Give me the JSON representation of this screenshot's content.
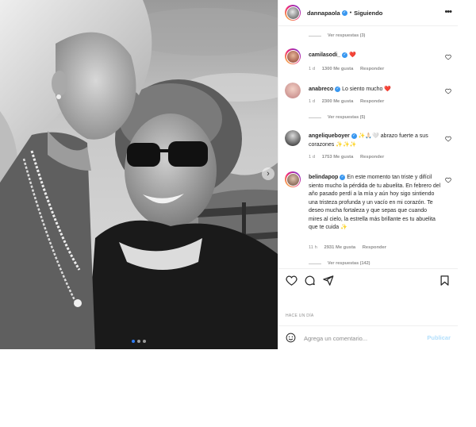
{
  "post": {
    "author": "dannapaola",
    "follow_state": "Siguiendo",
    "separator": "•",
    "posted_time": "HACE UN DÍA",
    "carousel": {
      "count": 3,
      "active": 0
    }
  },
  "icons": {
    "more": "more-horizontal-icon",
    "heart": "heart-outline-icon",
    "comment": "comment-bubble-icon",
    "share": "paper-plane-icon",
    "save": "bookmark-icon",
    "emoji": "smiley-icon",
    "verified": "verified-badge-icon"
  },
  "colors": {
    "verified": "#3897f0",
    "link_blue_disabled": "#b2dffc",
    "muted": "#8e8e8e"
  },
  "thread": {
    "replies_1": "Ver respuestas (3)",
    "replies_2": "Ver respuestas (5)",
    "replies_3": "Ver respuestas (142)"
  },
  "comments": [
    {
      "user": "camilasodi_",
      "text": "❤️",
      "time": "1 d",
      "likes": "1300 Me gusta",
      "reply": "Responder"
    },
    {
      "user": "anabreco",
      "text": "Lo siento mucho ❤️",
      "time": "1 d",
      "likes": "2300 Me gusta",
      "reply": "Responder"
    },
    {
      "user": "angeliqueboyer",
      "text": "✨🙏🏻🤍 abrazo fuerte a sus corazones ✨✨✨",
      "time": "1 d",
      "likes": "1753 Me gusta",
      "reply": "Responder"
    },
    {
      "user": "belindapop",
      "text": "En este momento tan triste y difícil siento mucho la pérdida de tu abuelita. En febrero del año pasado perdí a la mía y aún hoy sigo sintiendo una tristeza profunda y un vacío en mi corazón. Te deseo mucha fortaleza y que sepas que cuando mires al cielo, la estrella más brillante es tu abuelita que te cuida ✨",
      "time": "11 h",
      "likes": "2931 Me gusta",
      "reply": "Responder"
    }
  ],
  "composer": {
    "placeholder": "Agrega un comentario...",
    "publish_label": "Publicar"
  }
}
